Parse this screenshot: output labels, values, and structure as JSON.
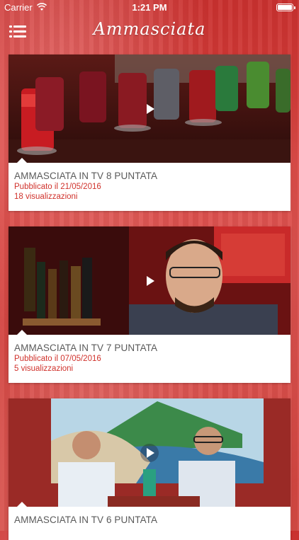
{
  "status_bar": {
    "carrier": "Carrier",
    "time": "1:21 PM"
  },
  "nav": {
    "title": "Ammasciata",
    "menu_icon": "hamburger-menu-icon"
  },
  "colors": {
    "accent": "#d0322c",
    "title_text": "#5a5a5a",
    "card_bg": "#ffffff"
  },
  "videos": [
    {
      "title": "AMMASCIATA IN TV 8 PUNTATA",
      "published": "Pubblicato il 21/05/2016",
      "views": "18 visualizzazioni"
    },
    {
      "title": "AMMASCIATA IN TV 7 PUNTATA",
      "published": "Pubblicato il 07/05/2016",
      "views": "5 visualizzazioni"
    },
    {
      "title": "AMMASCIATA IN TV 6 PUNTATA",
      "published": "",
      "views": ""
    }
  ]
}
